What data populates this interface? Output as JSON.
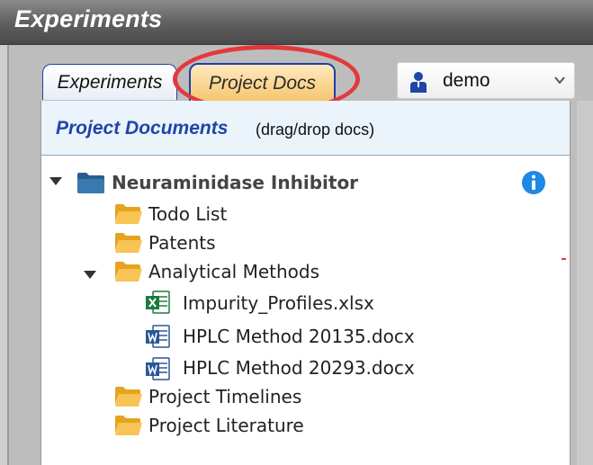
{
  "window": {
    "title": "Experiments"
  },
  "tabs": [
    {
      "label": "Experiments",
      "active": false
    },
    {
      "label": "Project Docs",
      "active": true
    }
  ],
  "user_select": {
    "value": "demo",
    "icon": "user-icon"
  },
  "panel": {
    "title": "Project Documents",
    "subtitle": "(drag/drop docs)"
  },
  "tree": {
    "root": {
      "label": "Neuraminidase Inhibitor",
      "icon": "folder-icon",
      "expanded": true
    },
    "items": [
      {
        "label": "Todo List",
        "icon": "folder-open-icon"
      },
      {
        "label": "Patents",
        "icon": "folder-open-icon"
      },
      {
        "label": "Analytical Methods",
        "icon": "folder-open-icon",
        "expanded": true
      },
      {
        "label": "Impurity_Profiles.xlsx",
        "icon": "excel-file-icon"
      },
      {
        "label": "HPLC Method 20135.docx",
        "icon": "word-file-icon"
      },
      {
        "label": "HPLC Method 20293.docx",
        "icon": "word-file-icon"
      },
      {
        "label": "Project Timelines",
        "icon": "folder-open-icon"
      },
      {
        "label": "Project Literature",
        "icon": "folder-open-icon"
      }
    ]
  },
  "colors": {
    "accent": "#1f45a6",
    "active_tab": "#f6c56e",
    "highlight": "#e4383d",
    "info": "#1e88e5",
    "excel": "#1d7a3e",
    "word": "#2b5797",
    "folder": "#f5b942"
  }
}
